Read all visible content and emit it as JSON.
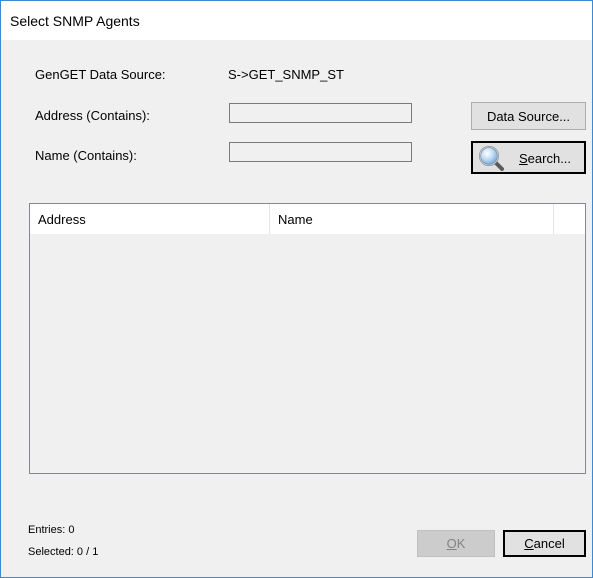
{
  "window": {
    "title": "Select SNMP Agents"
  },
  "form": {
    "datasource_label": "GenGET Data Source:",
    "datasource_value": "S->GET_SNMP_ST",
    "address_label": "Address (Contains):",
    "address_value": "",
    "name_label": "Name (Contains):",
    "name_value": ""
  },
  "buttons": {
    "datasource": "Data Source...",
    "search_ul": "S",
    "search_rest": "earch...",
    "ok_ul": "O",
    "ok_rest": "K",
    "cancel_ul": "C",
    "cancel_rest": "ancel"
  },
  "table": {
    "columns": [
      "Address",
      "Name"
    ],
    "rows": []
  },
  "status": {
    "entries": "Entries: 0",
    "selected": "Selected: 0 / 1"
  },
  "icons": {
    "search": "magnifier-icon"
  },
  "colors": {
    "window_border": "#3c8ad6",
    "dialog_bg": "#f0f0f0"
  }
}
